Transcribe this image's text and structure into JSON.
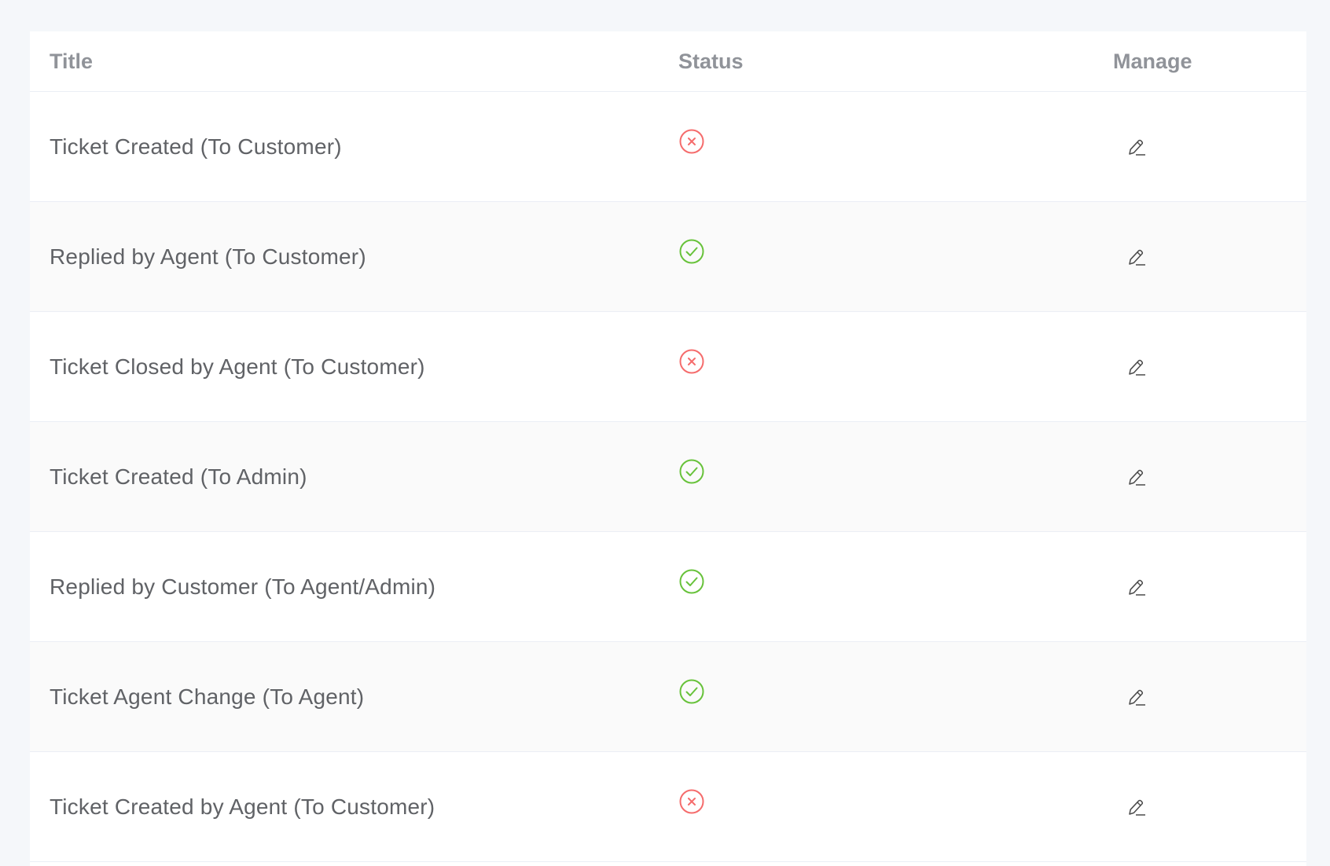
{
  "table": {
    "columns": {
      "title": "Title",
      "status": "Status",
      "manage": "Manage"
    },
    "rows": [
      {
        "title": "Ticket Created (To Customer)",
        "status": "disabled",
        "status_icon": "circle-x-icon"
      },
      {
        "title": "Replied by Agent (To Customer)",
        "status": "enabled",
        "status_icon": "circle-check-icon"
      },
      {
        "title": "Ticket Closed by Agent (To Customer)",
        "status": "disabled",
        "status_icon": "circle-x-icon"
      },
      {
        "title": "Ticket Created (To Admin)",
        "status": "enabled",
        "status_icon": "circle-check-icon"
      },
      {
        "title": "Replied by Customer (To Agent/Admin)",
        "status": "enabled",
        "status_icon": "circle-check-icon"
      },
      {
        "title": "Ticket Agent Change (To Agent)",
        "status": "enabled",
        "status_icon": "circle-check-icon"
      },
      {
        "title": "Ticket Created by Agent (To Customer)",
        "status": "disabled",
        "status_icon": "circle-x-icon"
      }
    ],
    "manage_icon": "edit-pencil-icon"
  },
  "colors": {
    "enabled": "#67c23a",
    "disabled": "#f56c6c",
    "header_text": "#909399",
    "body_text": "#606266",
    "border": "#ebeef5",
    "stripe": "#fafafa",
    "page_bg": "#f5f7fa"
  }
}
